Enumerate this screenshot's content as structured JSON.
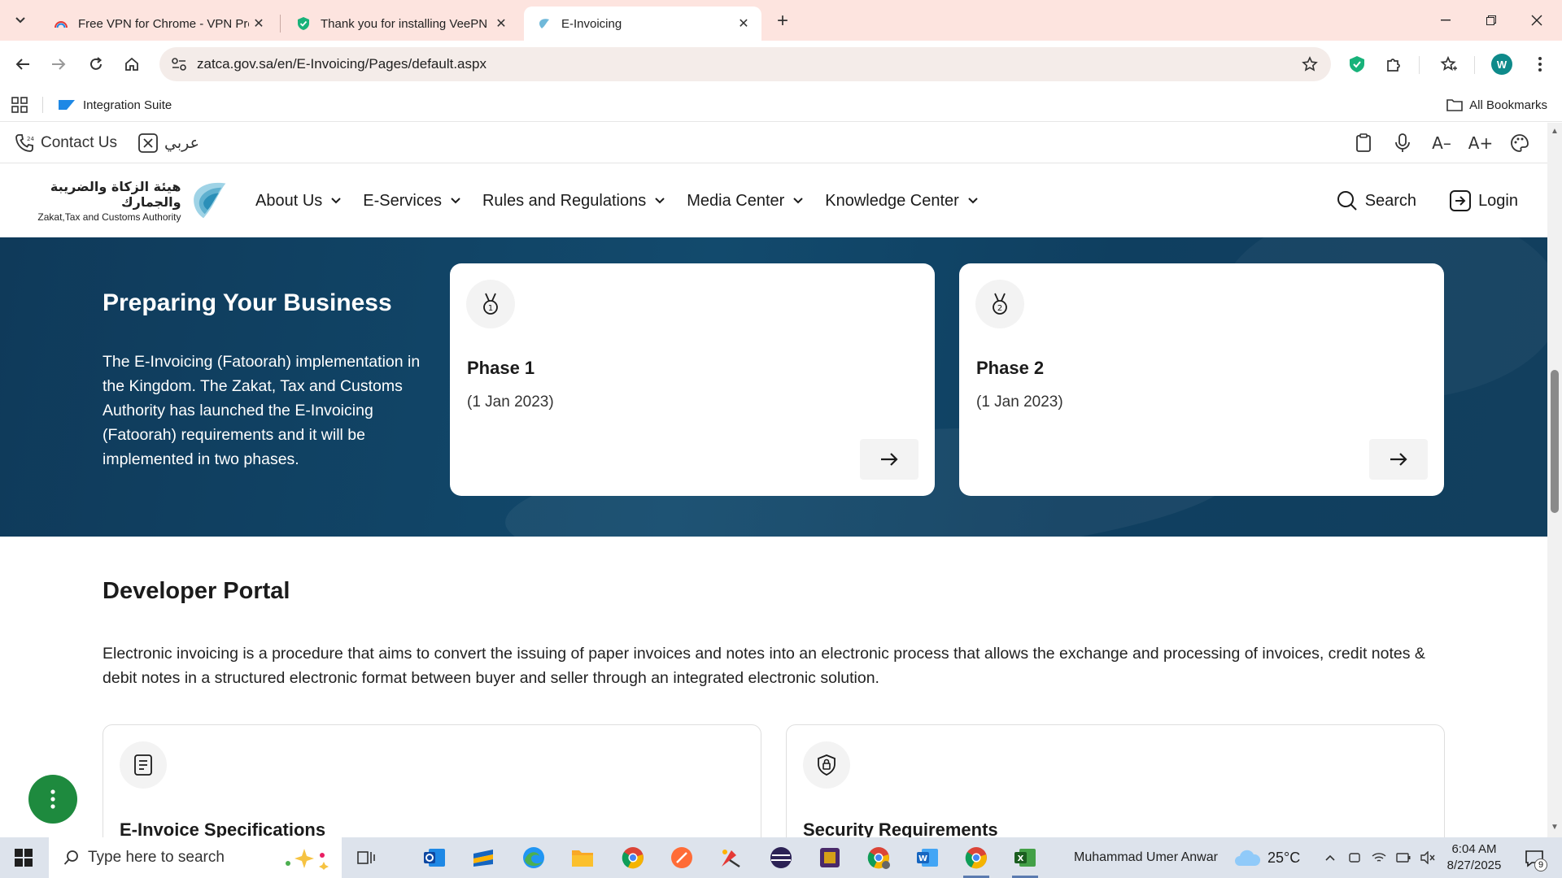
{
  "browser": {
    "tabs": [
      {
        "title": "Free VPN for Chrome - VPN Pro",
        "favicon": "rainbow-icon"
      },
      {
        "title": "Thank you for installing VeePN",
        "favicon": "shield-icon"
      },
      {
        "title": "E-Invoicing",
        "favicon": "zatca-icon",
        "active": true
      }
    ],
    "url": "zatca.gov.sa/en/E-Invoicing/Pages/default.aspx",
    "profile_initial": "W",
    "bookmarks": [
      {
        "label": "Integration Suite"
      }
    ],
    "all_bookmarks_label": "All Bookmarks",
    "accent": "#fde4df"
  },
  "util_bar": {
    "contact": "Contact Us",
    "arabic": "عربي"
  },
  "nav": {
    "logo_ar": "هيئة الزكاة والضريبة والجمارك",
    "logo_en": "Zakat,Tax and Customs Authority",
    "menu": [
      {
        "label": "About Us"
      },
      {
        "label": "E-Services"
      },
      {
        "label": "Rules and Regulations"
      },
      {
        "label": "Media Center"
      },
      {
        "label": "Knowledge Center"
      }
    ],
    "search": "Search",
    "login": "Login"
  },
  "hero": {
    "title": "Preparing Your Business",
    "text": "The E-Invoicing (Fatoorah) implementation in the Kingdom. The Zakat, Tax and Customs Authority has launched the E-Invoicing (Fatoorah) requirements and it will be implemented in two phases.",
    "phases": [
      {
        "title": "Phase 1",
        "date": "(1 Jan 2023)"
      },
      {
        "title": "Phase 2",
        "date": "(1 Jan 2023)"
      }
    ],
    "bg_color": "#124a6d"
  },
  "developer": {
    "title": "Developer Portal",
    "text": "Electronic invoicing is a procedure that aims to convert the issuing of paper invoices and notes into an electronic process that allows the exchange and processing of invoices, credit notes & debit notes in a structured electronic format between buyer and seller through an integrated electronic solution.",
    "cards": [
      {
        "title": "E-Invoice Specifications",
        "icon": "document-icon"
      },
      {
        "title": "Security Requirements",
        "icon": "lock-shield-icon"
      }
    ]
  },
  "taskbar": {
    "search_placeholder": "Type here to search",
    "user": "Muhammad Umer Anwar",
    "weather": "25°C",
    "time": "6:04 AM",
    "date": "8/27/2025",
    "notifications": "9"
  }
}
